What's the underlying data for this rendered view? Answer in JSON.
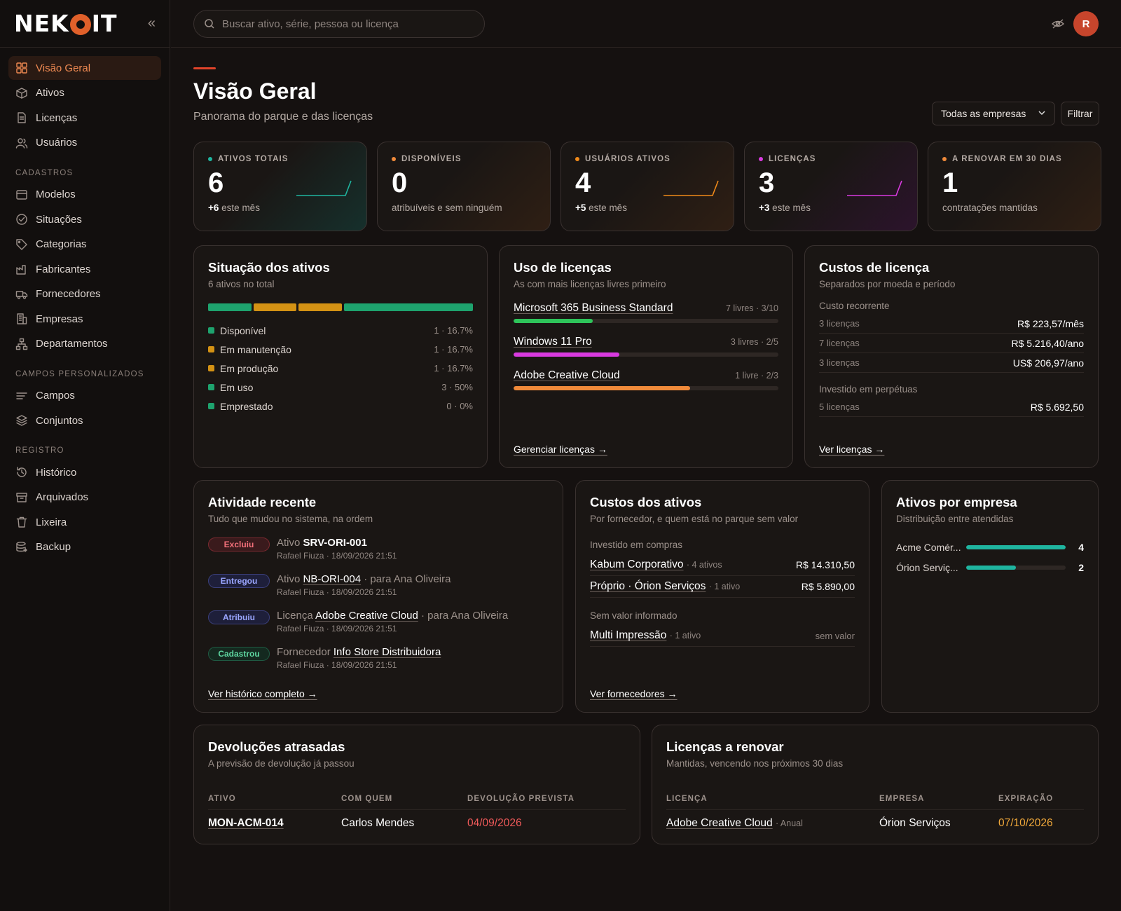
{
  "brand": {
    "name": "NEKOIT",
    "name_before": "NEK",
    "name_after": "IT"
  },
  "search": {
    "placeholder": "Buscar ativo, série, pessoa ou licença"
  },
  "user": {
    "avatar_initial": "R",
    "avatar_color": "#c7452c"
  },
  "sidebar": {
    "main": [
      {
        "label": "Visão Geral",
        "icon": "grid-icon",
        "active": true
      },
      {
        "label": "Ativos",
        "icon": "box-icon"
      },
      {
        "label": "Licenças",
        "icon": "document-icon"
      },
      {
        "label": "Usuários",
        "icon": "users-icon"
      }
    ],
    "sections": [
      {
        "title": "CADASTROS",
        "items": [
          {
            "label": "Modelos",
            "icon": "window-icon"
          },
          {
            "label": "Situações",
            "icon": "check-circle-icon"
          },
          {
            "label": "Categorias",
            "icon": "tag-icon"
          },
          {
            "label": "Fabricantes",
            "icon": "factory-icon"
          },
          {
            "label": "Fornecedores",
            "icon": "truck-icon"
          },
          {
            "label": "Empresas",
            "icon": "building-icon"
          },
          {
            "label": "Departamentos",
            "icon": "sitemap-icon"
          }
        ]
      },
      {
        "title": "CAMPOS PERSONALIZADOS",
        "items": [
          {
            "label": "Campos",
            "icon": "lines-icon"
          },
          {
            "label": "Conjuntos",
            "icon": "layers-icon"
          }
        ]
      },
      {
        "title": "REGISTRO",
        "items": [
          {
            "label": "Histórico",
            "icon": "history-icon"
          },
          {
            "label": "Arquivados",
            "icon": "archive-icon"
          },
          {
            "label": "Lixeira",
            "icon": "trash-icon"
          },
          {
            "label": "Backup",
            "icon": "database-icon"
          }
        ]
      }
    ]
  },
  "page": {
    "title": "Visão Geral",
    "subtitle": "Panorama do parque e das licenças",
    "company_select": "Todas as empresas",
    "filter_label": "Filtrar"
  },
  "kpis": [
    {
      "label": "ATIVOS TOTAIS",
      "value": "6",
      "delta": "+6",
      "foot": "este mês",
      "color": "#1fb5a0",
      "tint": "#16302c"
    },
    {
      "label": "DISPONÍVEIS",
      "value": "0",
      "delta": "",
      "foot": "atribuíveis e sem ninguém",
      "color": "#f08a3a",
      "tint": "#2f1f14"
    },
    {
      "label": "USUÁRIOS ATIVOS",
      "value": "4",
      "delta": "+5",
      "foot": "este mês",
      "color": "#f08a1a",
      "tint": "#2f1f14"
    },
    {
      "label": "LICENÇAS",
      "value": "3",
      "delta": "+3",
      "foot": "este mês",
      "color": "#d93ae0",
      "tint": "#2c142c"
    },
    {
      "label": "A RENOVAR EM 30 DIAS",
      "value": "1",
      "delta": "",
      "foot": "contratações mantidas",
      "color": "#f08a3a",
      "tint": "#2f1f14"
    }
  ],
  "status": {
    "title": "Situação dos ativos",
    "subtitle": "6 ativos no total",
    "items": [
      {
        "label": "Disponível",
        "count": "1 · 16.7%",
        "share": 16.7,
        "color": "#1ea36e"
      },
      {
        "label": "Em manutenção",
        "count": "1 · 16.7%",
        "share": 16.7,
        "color": "#d49214"
      },
      {
        "label": "Em produção",
        "count": "1 · 16.7%",
        "share": 16.7,
        "color": "#d49214"
      },
      {
        "label": "Em uso",
        "count": "3 · 50%",
        "share": 50,
        "color": "#1ea36e"
      },
      {
        "label": "Emprestado",
        "count": "0 · 0%",
        "share": 0,
        "color": "#1ea36e"
      }
    ]
  },
  "license_usage": {
    "title": "Uso de licenças",
    "subtitle": "As com mais licenças livres primeiro",
    "items": [
      {
        "name": "Microsoft 365 Business Standard",
        "meta": "7 livres · 3/10",
        "used": 3,
        "total": 10,
        "color": "#2ec45a"
      },
      {
        "name": "Windows 11 Pro",
        "meta": "3 livres · 2/5",
        "used": 2,
        "total": 5,
        "color": "#d93ae0"
      },
      {
        "name": "Adobe Creative Cloud",
        "meta": "1 livre · 2/3",
        "used": 2,
        "total": 3,
        "color": "#f08a3a"
      }
    ],
    "link": "Gerenciar licenças →"
  },
  "license_costs": {
    "title": "Custos de licença",
    "subtitle": "Separados por moeda e período",
    "recurring_label": "Custo recorrente",
    "recurring": [
      {
        "qty": "3 licenças",
        "amount": "R$ 223,57/mês"
      },
      {
        "qty": "7 licenças",
        "amount": "R$ 5.216,40/ano"
      },
      {
        "qty": "3 licenças",
        "amount": "US$ 206,97/ano"
      }
    ],
    "perpetual_label": "Investido em perpétuas",
    "perpetual": [
      {
        "qty": "5 licenças",
        "amount": "R$ 5.692,50"
      }
    ],
    "link": "Ver licenças →"
  },
  "activity": {
    "title": "Atividade recente",
    "subtitle": "Tudo que mudou no sistema, na ordem",
    "items": [
      {
        "badge": "Excluiu",
        "kind": "red",
        "type": "Ativo",
        "ref": "SRV-ORI-001",
        "plain": true,
        "extra": "",
        "by": "Rafael Fiuza · 18/09/2026 21:51"
      },
      {
        "badge": "Entregou",
        "kind": "blue",
        "type": "Ativo",
        "ref": "NB-ORI-004",
        "plain": false,
        "extra": "· para Ana Oliveira",
        "by": "Rafael Fiuza · 18/09/2026 21:51"
      },
      {
        "badge": "Atribuiu",
        "kind": "blue",
        "type": "Licença",
        "ref": "Adobe Creative Cloud",
        "plain": false,
        "extra": "· para Ana Oliveira",
        "by": "Rafael Fiuza · 18/09/2026 21:51"
      },
      {
        "badge": "Cadastrou",
        "kind": "green",
        "type": "Fornecedor",
        "ref": "Info Store Distribuidora",
        "plain": false,
        "extra": "",
        "by": "Rafael Fiuza · 18/09/2026 21:51"
      }
    ],
    "link": "Ver histórico completo →"
  },
  "asset_costs": {
    "title": "Custos dos ativos",
    "subtitle": "Por fornecedor, e quem está no parque sem valor",
    "invested_label": "Investido em compras",
    "invested": [
      {
        "name": "Kabum Corporativo",
        "count": "· 4 ativos",
        "amount": "R$ 14.310,50"
      },
      {
        "name": "Próprio · Órion Serviços",
        "count": "· 1 ativo",
        "amount": "R$ 5.890,00"
      }
    ],
    "novalue_label": "Sem valor informado",
    "novalue": [
      {
        "name": "Multi Impressão",
        "count": "· 1 ativo",
        "amount": "sem valor"
      }
    ],
    "link": "Ver fornecedores →"
  },
  "by_company": {
    "title": "Ativos por empresa",
    "subtitle": "Distribuição entre atendidas",
    "items": [
      {
        "name": "Acme Comér...",
        "count": "4",
        "value": 4
      },
      {
        "name": "Órion Serviç...",
        "count": "2",
        "value": 2
      }
    ]
  },
  "overdue": {
    "title": "Devoluções atrasadas",
    "subtitle": "A previsão de devolução já passou",
    "headers": [
      "ATIVO",
      "COM QUEM",
      "DEVOLUÇÃO PREVISTA"
    ],
    "rows": [
      {
        "asset": "MON-ACM-014",
        "who": "Carlos Mendes",
        "date": "04/09/2026"
      }
    ]
  },
  "renew": {
    "title": "Licenças a renovar",
    "subtitle": "Mantidas, vencendo nos próximos 30 dias",
    "headers": [
      "LICENÇA",
      "EMPRESA",
      "EXPIRAÇÃO"
    ],
    "rows": [
      {
        "license": "Adobe Creative Cloud",
        "period": "· Anual",
        "company": "Órion Serviços",
        "expires": "07/10/2026"
      }
    ]
  }
}
